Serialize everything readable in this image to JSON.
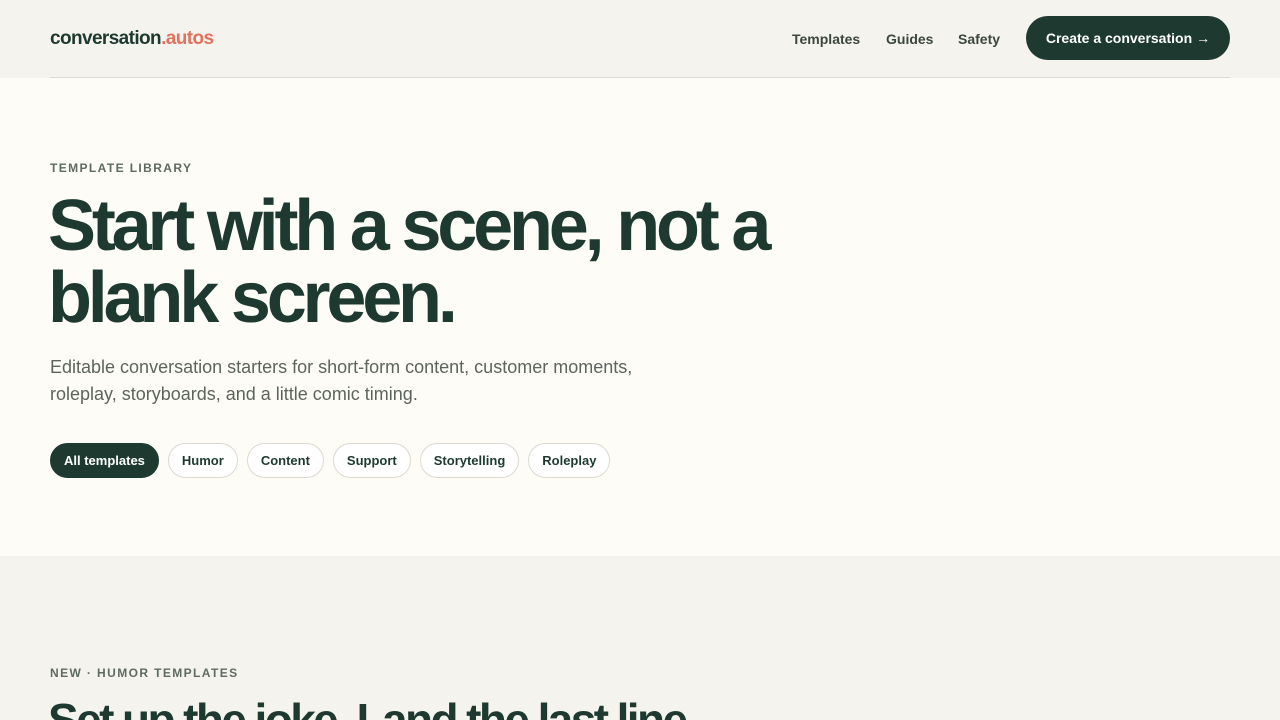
{
  "header": {
    "logo_main": "conversation",
    "logo_accent": ".autos",
    "nav": [
      {
        "label": "Templates"
      },
      {
        "label": "Guides"
      },
      {
        "label": "Safety"
      }
    ],
    "cta_label": "Create a conversation",
    "cta_icon": "→"
  },
  "hero": {
    "eyebrow": "TEMPLATE LIBRARY",
    "headline": "Start with a scene, not a blank screen.",
    "subtitle": "Editable conversation starters for short-form content, customer moments, roleplay, storyboards, and a little comic timing.",
    "filters": [
      {
        "label": "All templates",
        "active": true
      },
      {
        "label": "Humor",
        "active": false
      },
      {
        "label": "Content",
        "active": false
      },
      {
        "label": "Support",
        "active": false
      },
      {
        "label": "Storytelling",
        "active": false
      },
      {
        "label": "Roleplay",
        "active": false
      }
    ]
  },
  "section2": {
    "eyebrow": "NEW · HUMOR TEMPLATES",
    "title": "Set up the joke. Land the last line."
  },
  "colors": {
    "brand": "#1e3a30",
    "accent": "#e0735f",
    "page_bg": "#f5f3ee",
    "hero_bg": "#fdfcf7"
  }
}
